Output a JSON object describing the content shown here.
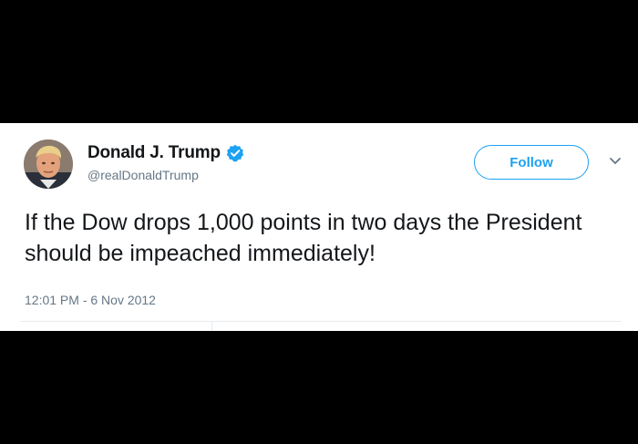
{
  "tweet": {
    "author": {
      "display_name": "Donald J. Trump",
      "handle": "@realDonaldTrump",
      "verified_icon": "verified-badge-icon"
    },
    "follow_label": "Follow",
    "text": "If the Dow drops 1,000 points in two days the President should be impeached immediately!",
    "timestamp": "12:01 PM - 6 Nov 2012"
  },
  "colors": {
    "background": "#000000",
    "card": "#ffffff",
    "accent": "#1da1f2",
    "text": "#14171a",
    "secondary_text": "#657786"
  }
}
